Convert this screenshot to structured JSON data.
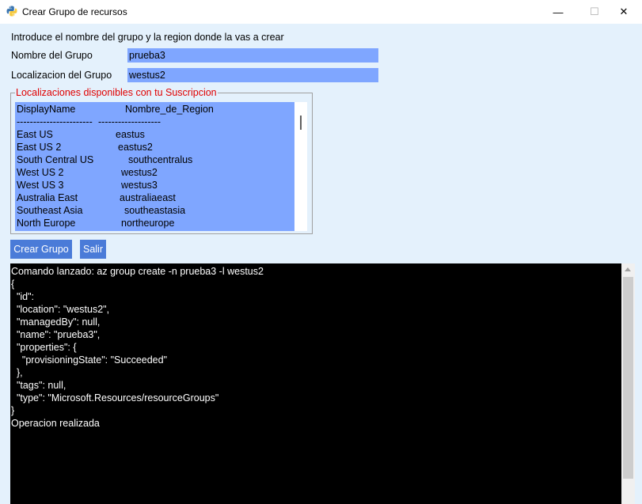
{
  "window": {
    "title": "Crear Grupo de recursos",
    "minimize": "—",
    "maximize": "☐",
    "close": "✕",
    "icon": "python-icon"
  },
  "form": {
    "intro": "Introduce el nombre del grupo y la region donde la vas a crear",
    "group_label": "Nombre del Grupo",
    "group_value": "prueba3",
    "location_label": "Localizacion del Grupo",
    "location_value": "westus2"
  },
  "locations": {
    "legend": "Localizaciones disponibles con tu Suscripcion",
    "rows": [
      {
        "name": "DisplayName",
        "region": "Nombre_de_Region"
      },
      {
        "name": "-----------------------",
        "region": "-------------------"
      },
      {
        "name": "East US",
        "region": "eastus"
      },
      {
        "name": "East US 2",
        "region": "eastus2"
      },
      {
        "name": "South Central US",
        "region": "southcentralus"
      },
      {
        "name": "West US 2",
        "region": "westus2"
      },
      {
        "name": "West US 3",
        "region": "westus3"
      },
      {
        "name": "Australia East",
        "region": "australiaeast"
      },
      {
        "name": "Southeast Asia",
        "region": "southeastasia"
      },
      {
        "name": "North Europe",
        "region": "northeurope"
      }
    ]
  },
  "buttons": {
    "create": "Crear Grupo",
    "exit": "Salir"
  },
  "console": {
    "lines": [
      "Comando lanzado: az group create -n prueba3 -l westus2",
      "{",
      "  \"id\":",
      "  \"location\": \"westus2\",",
      "  \"managedBy\": null,",
      "  \"name\": \"prueba3\",",
      "  \"properties\": {",
      "    \"provisioningState\": \"Succeeded\"",
      "  },",
      "  \"tags\": null,",
      "  \"type\": \"Microsoft.Resources/resourceGroups\"",
      "}",
      "Operacion realizada"
    ]
  },
  "colors": {
    "client_bg": "#e4f1fc",
    "entry_bg": "#7fa6ff",
    "button_bg": "#4a7bd8",
    "legend_text": "#e00000",
    "console_bg": "#000000"
  }
}
